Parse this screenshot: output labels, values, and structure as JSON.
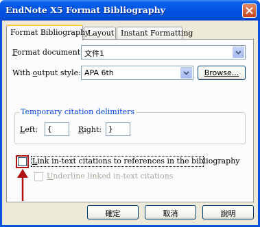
{
  "window": {
    "title": "EndNote X5 Format Bibliography"
  },
  "tabs": [
    {
      "label": "Format Bibliography",
      "active": true
    },
    {
      "label": "Layout",
      "active": false
    },
    {
      "label": "Instant Formatting",
      "active": false
    }
  ],
  "format_document": {
    "label": "Format document:",
    "label_underline_char": "F",
    "label_rest": "ormat document:",
    "value": "文件1"
  },
  "output_style": {
    "label_pre": "With ",
    "label_underline_char": "o",
    "label_rest": "utput style:",
    "value": "APA 6th",
    "browse_label": "Browse..."
  },
  "delimiters": {
    "title": "Temporary citation delimiters",
    "left_label_char": "L",
    "left_label_rest": "eft:",
    "left_value": "{",
    "right_label_char": "R",
    "right_label_rest": "ight:",
    "right_value": "}"
  },
  "link_checkbox": {
    "label_char": "L",
    "label_rest": "ink in-text citations to references in the bibliography",
    "checked": false
  },
  "underline_checkbox": {
    "label_char": "U",
    "label_rest": "nderline linked in-text citations",
    "checked": false,
    "enabled": false
  },
  "buttons": {
    "ok": "確定",
    "cancel": "取消",
    "help": "說明"
  },
  "annotation": {
    "color": "#b01010",
    "icon": "arrow-up-icon"
  }
}
